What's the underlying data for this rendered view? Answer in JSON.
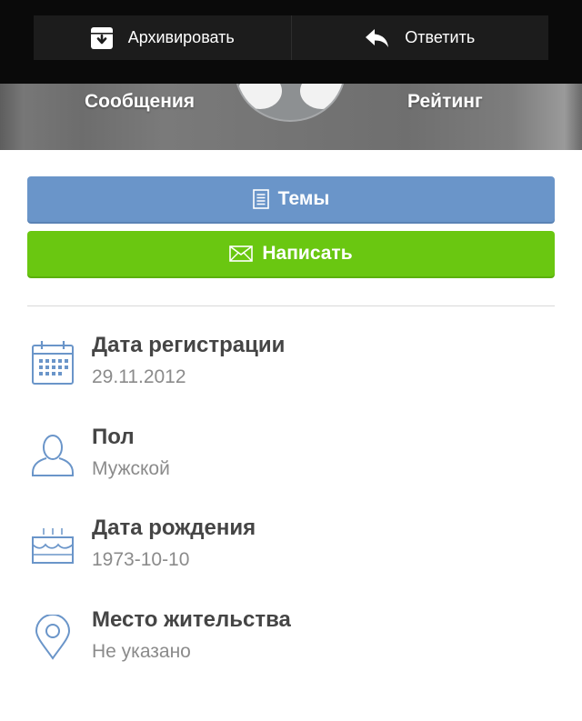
{
  "action_bar": {
    "archive_label": "Архивировать",
    "reply_label": "Ответить",
    "icons": {
      "archive": "archive-icon",
      "reply": "reply-icon"
    }
  },
  "profile_header": {
    "messages_label": "Сообщения",
    "rating_label": "Рейтинг"
  },
  "buttons": {
    "topics_label": "Темы",
    "topics_icon": "document-icon",
    "write_label": "Написать",
    "write_icon": "envelope-icon"
  },
  "info": [
    {
      "title": "Дата регистрации",
      "value": "29.11.2012",
      "icon": "calendar-icon"
    },
    {
      "title": "Пол",
      "value": "Мужской",
      "icon": "person-icon"
    },
    {
      "title": "Дата рождения",
      "value": "1973-10-10",
      "icon": "birthday-cake-icon"
    },
    {
      "title": "Место жительства",
      "value": "Не указано",
      "icon": "location-pin-icon"
    }
  ],
  "colors": {
    "topics_button": "#6a95c9",
    "write_button": "#6ac711",
    "icon_blue": "#6a95c9",
    "title_text": "#454545",
    "value_text": "#8b8b8b"
  }
}
